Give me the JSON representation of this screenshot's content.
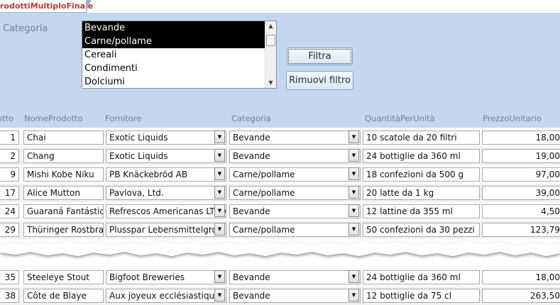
{
  "tab": {
    "title": "rodottiMultiploFinale"
  },
  "filter": {
    "label": "Categoria",
    "listbox_items": [
      {
        "text": "Bevande",
        "selected": true
      },
      {
        "text": "Carne/pollame",
        "selected": true
      },
      {
        "text": "Cereali",
        "selected": false
      },
      {
        "text": "Condimenti",
        "selected": false
      },
      {
        "text": "Dolciumi",
        "selected": false
      }
    ],
    "btn_filtra": "Filtra",
    "btn_rimuovi": "Rimuovi filtro"
  },
  "columns": {
    "id": "otto",
    "nome": "NomeProdotto",
    "fornitore": "Fornitore",
    "categoria": "Categoria",
    "quantita": "QuantitàPerUnità",
    "prezzo": "PrezzoUnitario"
  },
  "rows_top": [
    {
      "id": "1",
      "nome": "Chai",
      "fornitore": "Exotic Liquids",
      "categoria": "Bevande",
      "quantita": "10 scatole da 20 filtri",
      "prezzo": "18,00"
    },
    {
      "id": "2",
      "nome": "Chang",
      "fornitore": "Exotic Liquids",
      "categoria": "Bevande",
      "quantita": "24 bottiglie da 360 ml",
      "prezzo": "19,00"
    },
    {
      "id": "9",
      "nome": "Mishi Kobe Niku",
      "fornitore": "PB Knäckebröd AB",
      "categoria": "Carne/pollame",
      "quantita": "18 confezioni da 500 g",
      "prezzo": "97,00"
    },
    {
      "id": "17",
      "nome": "Alice Mutton",
      "fornitore": "Pavlova, Ltd.",
      "categoria": "Carne/pollame",
      "quantita": "20 latte da 1 kg",
      "prezzo": "39,00"
    },
    {
      "id": "24",
      "nome": "Guaraná Fantástica",
      "fornitore": "Refrescos Americanas LTDA",
      "categoria": "Bevande",
      "quantita": "12 lattine da 355 ml",
      "prezzo": "4,50"
    },
    {
      "id": "29",
      "nome": "Thüringer Rostbratw",
      "fornitore": "Plusspar Lebensmittelgroß",
      "categoria": "Carne/pollame",
      "quantita": "50 confezioni da 30 pezzi",
      "prezzo": "123,79"
    }
  ],
  "rows_bottom": [
    {
      "id": "35",
      "nome": "Steeleye Stout",
      "fornitore": "Bigfoot Breweries",
      "categoria": "Bevande",
      "quantita": "24 bottiglie da 360 ml",
      "prezzo": "18,00"
    },
    {
      "id": "38",
      "nome": "Côte de Blaye",
      "fornitore": "Aux joyeux ecclésiastiques",
      "categoria": "Bevande",
      "quantita": "12 bottiglie da 75 cl",
      "prezzo": "263,50"
    }
  ]
}
